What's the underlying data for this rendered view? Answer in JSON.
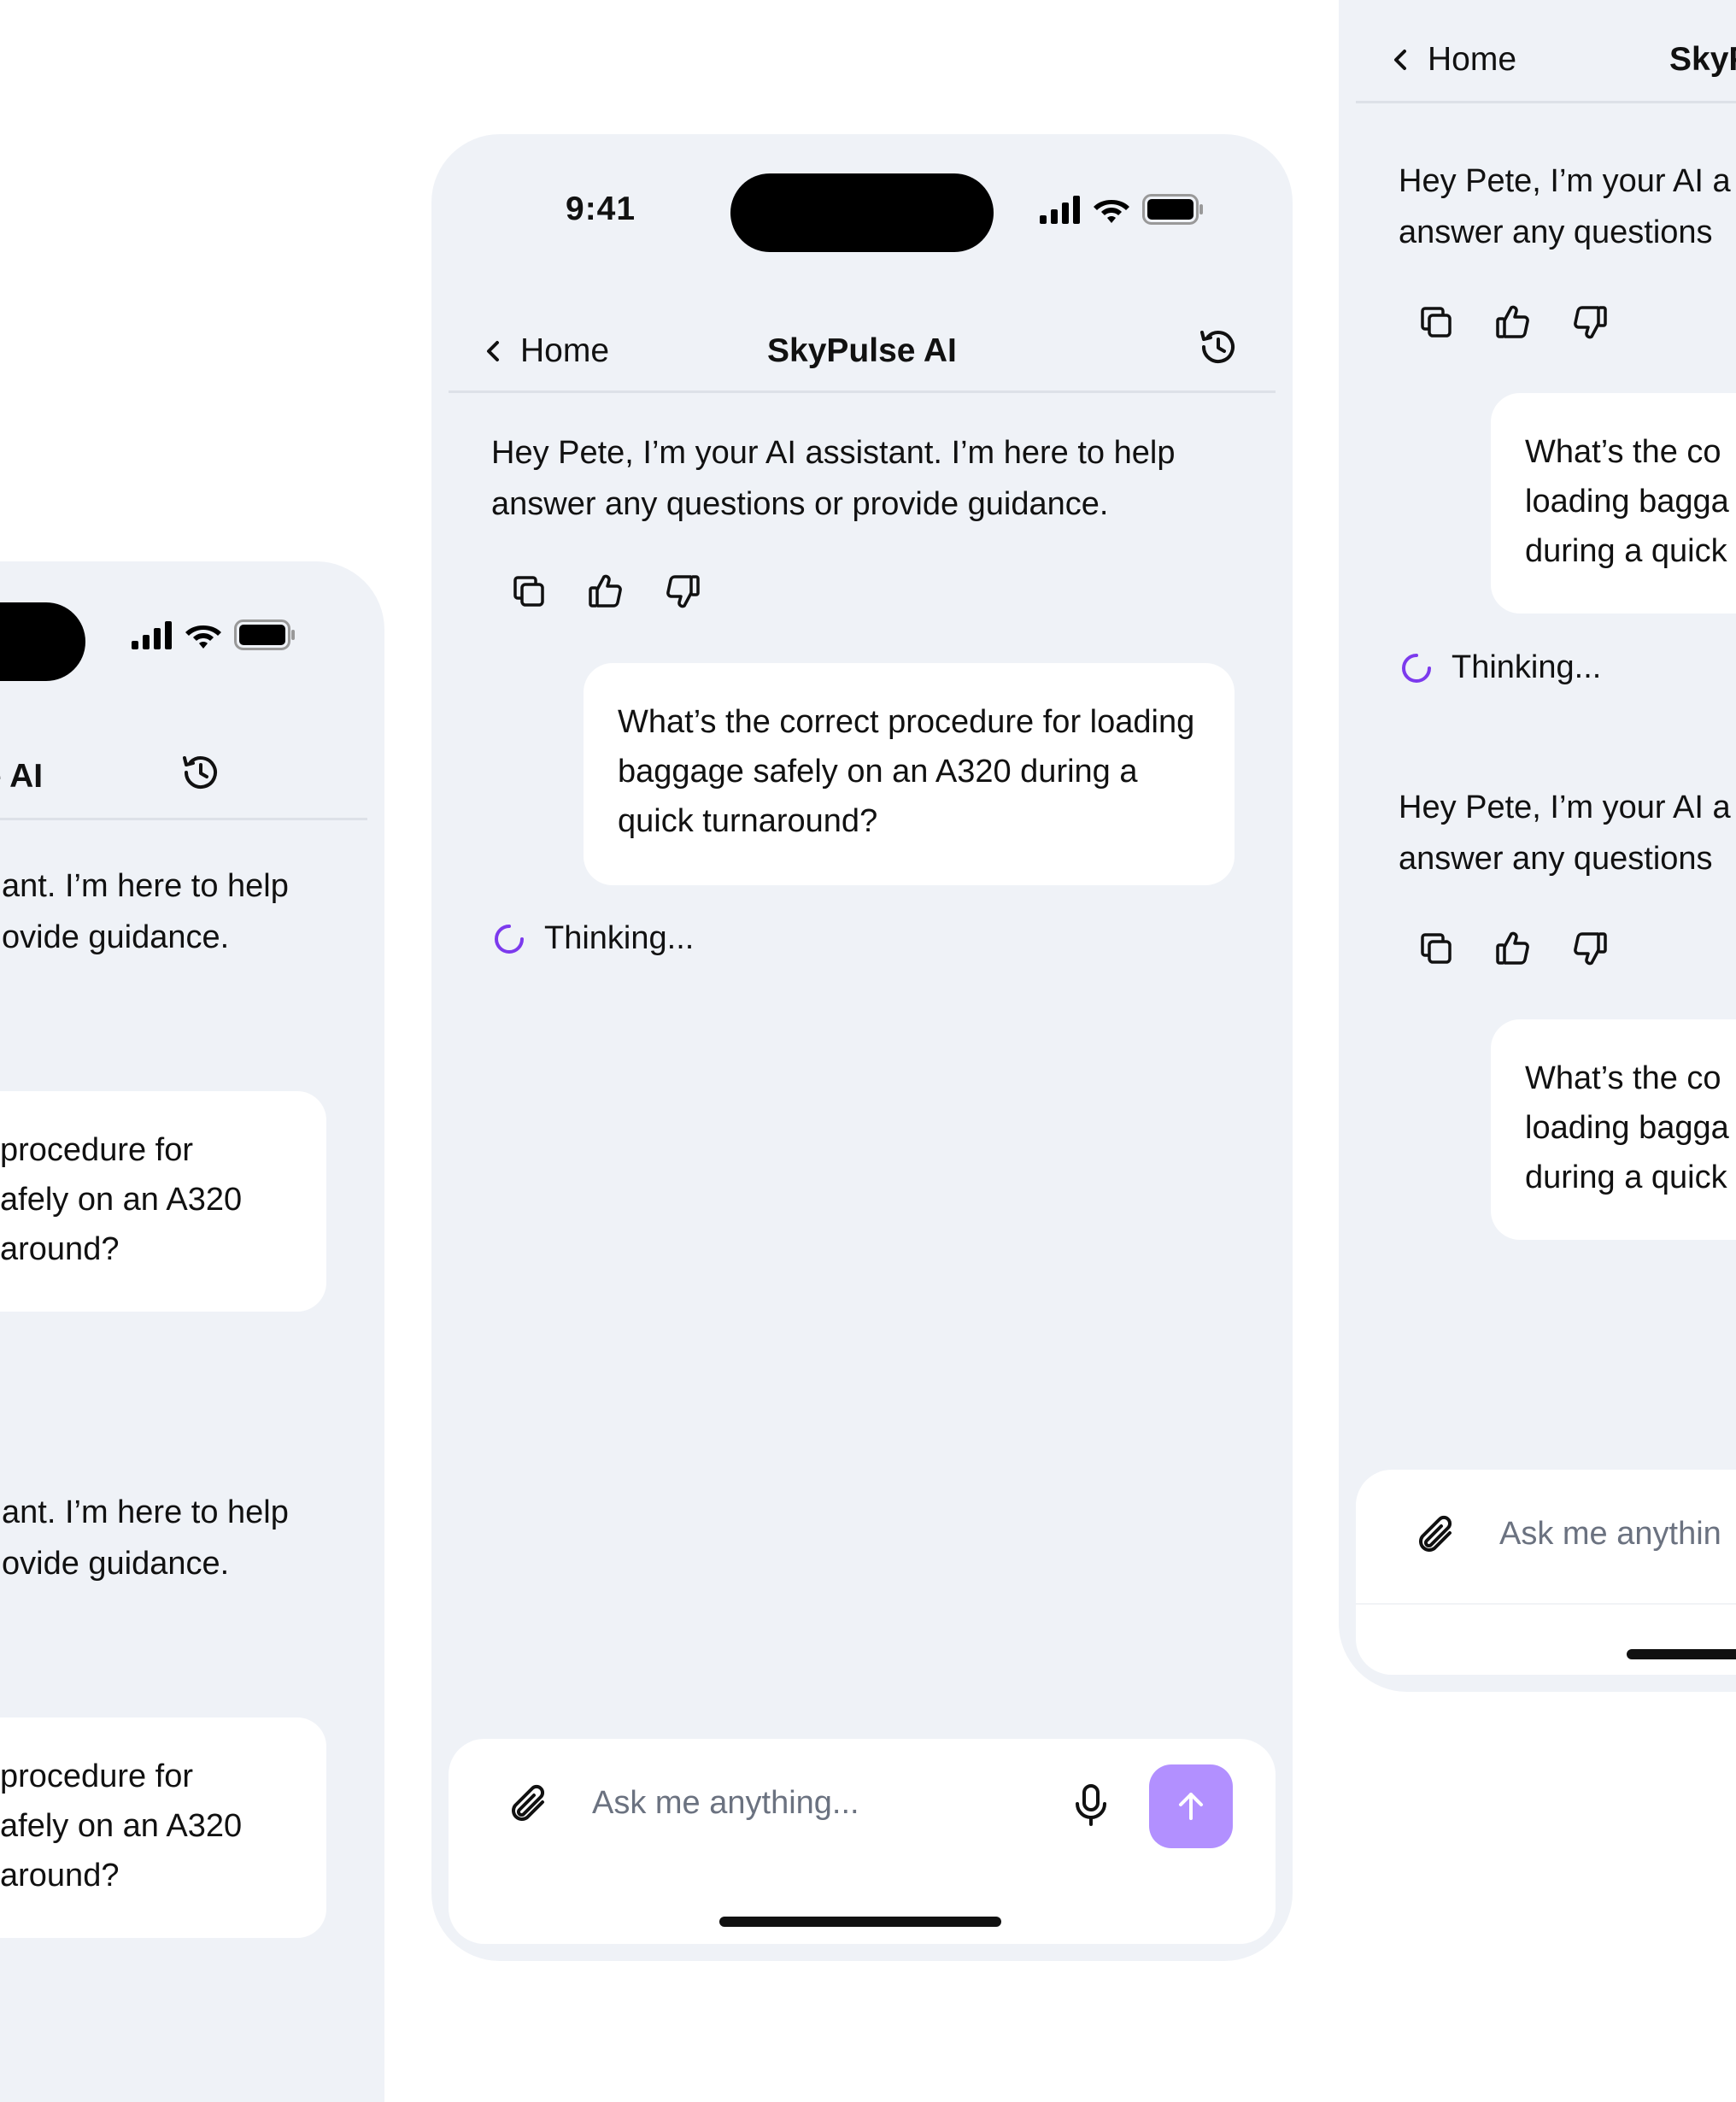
{
  "status": {
    "time": "9:41"
  },
  "nav": {
    "back_label": "Home",
    "title": "SkyPulse AI"
  },
  "assistant": {
    "message": "Hey Pete, I’m your AI assistant. I’m here to help answer any questions or provide guidance."
  },
  "user": {
    "message": "What’s the correct procedure for loading baggage safely on an A320 during a quick turnaround?"
  },
  "thinking": {
    "label": "Thinking..."
  },
  "composer": {
    "placeholder": "Ask me anything..."
  },
  "left_screen": {
    "title": "e AI",
    "assistant_lines": [
      "ant. I’m here to help",
      "ovide guidance."
    ],
    "user_lines": [
      "procedure for",
      "afely on an A320",
      "around?"
    ]
  },
  "right_screen": {
    "title": "SkyP",
    "assistant_lines": [
      "Hey Pete, I’m your AI a",
      "answer any questions"
    ],
    "user_lines": [
      "What’s the co",
      "loading bagga",
      "during a quick"
    ],
    "placeholder": "Ask me anythin"
  },
  "colors": {
    "background": "#eff2f7",
    "accent": "#7c3aed",
    "send_button": "#b290ff"
  },
  "icons": [
    "signal-icon",
    "wifi-icon",
    "battery-icon",
    "chevron-left-icon",
    "history-icon",
    "copy-icon",
    "thumbs-up-icon",
    "thumbs-down-icon",
    "spinner-icon",
    "paperclip-icon",
    "microphone-icon",
    "arrow-up-icon"
  ]
}
